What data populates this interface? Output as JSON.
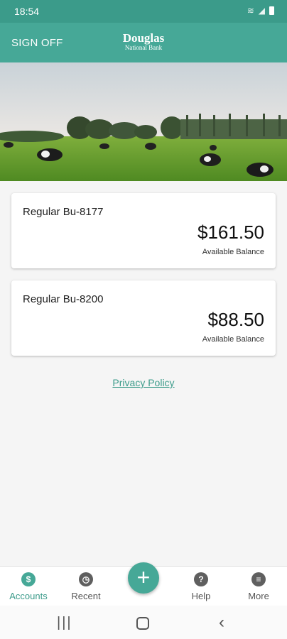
{
  "status_bar": {
    "time": "18:54"
  },
  "header": {
    "sign_off": "SIGN OFF",
    "logo_top": "Douglas",
    "logo_bottom": "National Bank"
  },
  "accounts": [
    {
      "name": "Regular Bu-8177",
      "amount": "$161.50",
      "label": "Available Balance"
    },
    {
      "name": "Regular Bu-8200",
      "amount": "$88.50",
      "label": "Available Balance"
    }
  ],
  "privacy_link": "Privacy Policy",
  "nav": {
    "accounts": "Accounts",
    "recent": "Recent",
    "help": "Help",
    "more": "More",
    "accounts_glyph": "$",
    "help_glyph": "?",
    "fab_glyph": "+"
  },
  "colors": {
    "primary": "#46a897",
    "primary_dark": "#3b9b8a"
  },
  "icons": [
    "wifi-icon",
    "signal-icon",
    "battery-icon",
    "dollar-icon",
    "clock-icon",
    "plus-icon",
    "help-icon",
    "menu-icon",
    "recents-icon",
    "home-icon",
    "back-icon"
  ]
}
